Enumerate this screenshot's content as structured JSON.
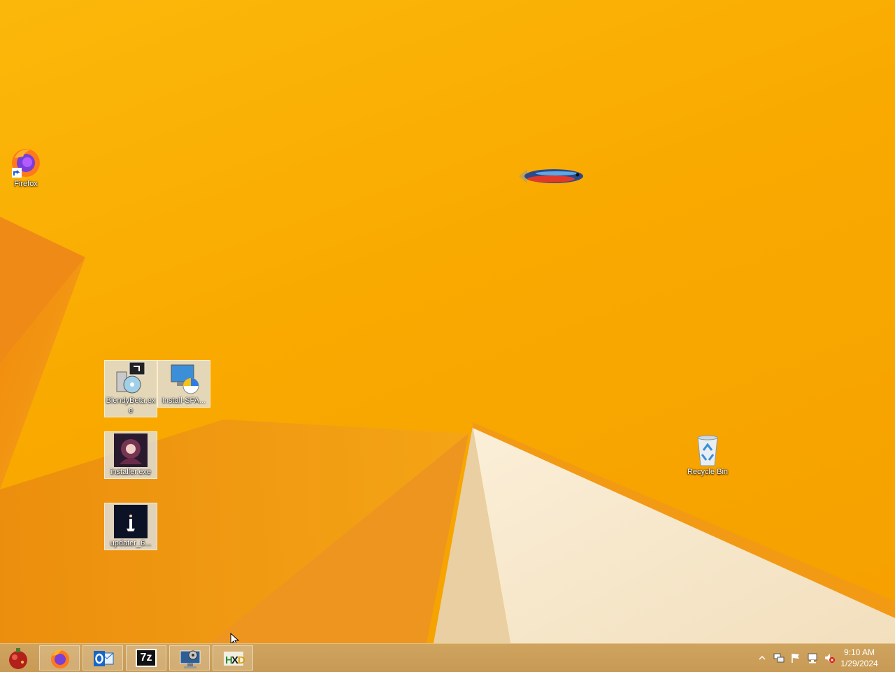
{
  "desktop": {
    "icons": [
      {
        "name": "firefox-shortcut",
        "label": "Firefox"
      },
      {
        "name": "blendybeta-file",
        "label": "BlendyBeta.exe"
      },
      {
        "name": "install-sfa-file",
        "label": "Install-SFA..."
      },
      {
        "name": "installer-file",
        "label": "installer.exe"
      },
      {
        "name": "updater-file",
        "label": "updater_6..."
      },
      {
        "name": "recycle-bin",
        "label": "Recycle Bin"
      }
    ]
  },
  "taskbar": {
    "apps": [
      "start-orb-icon",
      "firefox-icon",
      "outlook-icon",
      "7zip-icon",
      "system-monitor-icon",
      "hxd-icon"
    ],
    "apps_7z_label": "7z",
    "clock": {
      "time": "9:10 AM",
      "date": "1/29/2024"
    }
  },
  "colors": {
    "wallpaper": "#f9ad00",
    "taskbar": "#c99c58"
  }
}
